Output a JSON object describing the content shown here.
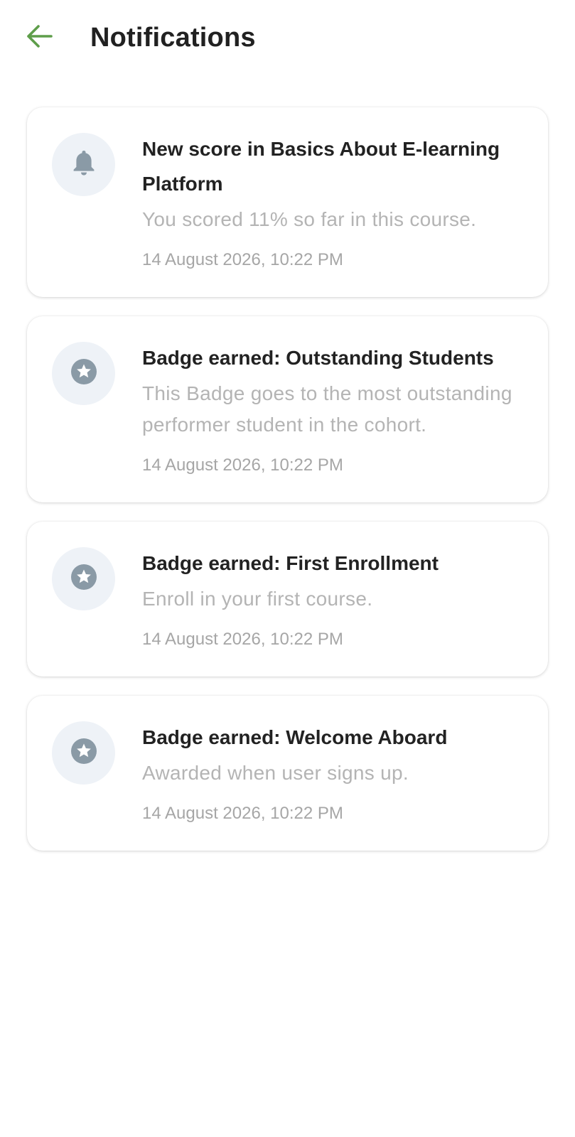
{
  "header": {
    "back_icon": "arrow-left-icon",
    "title": "Notifications",
    "accent_color": "#5e9e4a"
  },
  "notifications": [
    {
      "icon": "bell-icon",
      "title": "New score in Basics About E-learning Platform",
      "body": "You scored 11% so far in this course.",
      "time": "14 August 2026, 10:22 PM"
    },
    {
      "icon": "star-badge-icon",
      "title": "Badge earned: Outstanding Students",
      "body": "This Badge goes to the most outstanding performer student in the cohort.",
      "time": "14 August 2026, 10:22 PM"
    },
    {
      "icon": "star-badge-icon",
      "title": "Badge earned: First Enrollment",
      "body": "Enroll in your first course.",
      "time": "14 August 2026, 10:22 PM"
    },
    {
      "icon": "star-badge-icon",
      "title": "Badge earned: Welcome Aboard",
      "body": "Awarded when user signs up.",
      "time": "14 August 2026, 10:22 PM"
    }
  ],
  "colors": {
    "icon_gray": "#8a9aa6",
    "icon_bg": "#eef2f7"
  }
}
